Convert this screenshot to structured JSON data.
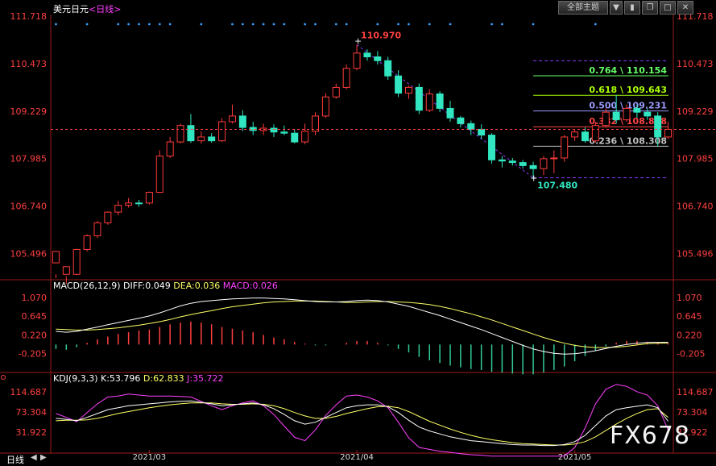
{
  "header": {
    "instrument": "美元日元",
    "period_tag": "<日线>",
    "theme_menu": "全部主题",
    "icons": [
      "dropdown-arrow-icon",
      "toggle-panel-icon",
      "restore-window-icon",
      "maximize-icon",
      "close-icon"
    ]
  },
  "colors": {
    "up": "#ff3a3a",
    "down": "#31e6c0",
    "background": "#000000",
    "grid": "#9b1b1b",
    "axis_text": "#ff4040",
    "diff": "#ffffff",
    "dea": "#ffff66",
    "macd_hist_pos": "#ff4040",
    "macd_hist_neg": "#33cc99",
    "k": "#ffffff",
    "d": "#ffff66",
    "j": "#ff40ff"
  },
  "chart_data": [
    {
      "type": "candlestick",
      "panel": "price",
      "title": "美元日元<日线>",
      "y_ticks": [
        "111.718",
        "110.473",
        "109.229",
        "107.985",
        "106.740",
        "105.496"
      ],
      "ylim": [
        104.85,
        111.718
      ],
      "last_price": 108.75,
      "high_label": "110.970",
      "low_label": "107.480",
      "x_tick_labels": [
        "2021/03",
        "2021/04",
        "2021/05"
      ],
      "x_tick_index": [
        9,
        29,
        50
      ],
      "fibonacci": [
        {
          "level": "0.764",
          "value": "110.154",
          "color": "#66ff66"
        },
        {
          "level": "0.618",
          "value": "109.643",
          "color": "#aaff00"
        },
        {
          "level": "0.500",
          "value": "109.231",
          "color": "#9999ff"
        },
        {
          "level": "0.382",
          "value": "108.818",
          "color": "#ff4444"
        },
        {
          "level": "0.236",
          "value": "108.308",
          "color": "#c0c0c0"
        }
      ],
      "candles": [
        [
          105.25,
          105.55,
          104.95,
          104.85
        ],
        [
          104.95,
          105.15,
          104.9,
          104.7
        ],
        [
          104.95,
          105.6,
          105.62,
          104.93
        ],
        [
          105.6,
          105.96,
          106.0,
          105.55
        ],
        [
          105.96,
          106.3,
          106.35,
          105.9
        ],
        [
          106.3,
          106.58,
          106.6,
          106.25
        ],
        [
          106.58,
          106.76,
          106.88,
          106.5
        ],
        [
          106.76,
          106.82,
          106.95,
          106.7
        ],
        [
          106.82,
          106.8,
          106.9,
          106.72
        ],
        [
          106.82,
          107.1,
          107.12,
          106.78
        ],
        [
          107.1,
          108.05,
          108.2,
          107.08
        ],
        [
          108.05,
          108.42,
          108.55,
          108.0
        ],
        [
          108.42,
          108.85,
          108.9,
          108.38
        ],
        [
          108.85,
          108.45,
          109.15,
          108.4
        ],
        [
          108.45,
          108.55,
          108.7,
          108.38
        ],
        [
          108.55,
          108.45,
          108.65,
          108.4
        ],
        [
          108.45,
          108.95,
          109.05,
          108.42
        ],
        [
          108.95,
          109.1,
          109.4,
          108.9
        ],
        [
          109.1,
          108.8,
          109.25,
          108.7
        ],
        [
          108.8,
          108.72,
          108.95,
          108.6
        ],
        [
          108.72,
          108.78,
          108.9,
          108.6
        ],
        [
          108.78,
          108.68,
          108.88,
          108.55
        ],
        [
          108.68,
          108.65,
          108.85,
          108.6
        ],
        [
          108.65,
          108.42,
          108.75,
          108.38
        ],
        [
          108.42,
          108.7,
          108.9,
          108.36
        ],
        [
          108.7,
          109.1,
          109.2,
          108.6
        ],
        [
          109.1,
          109.6,
          109.7,
          109.05
        ],
        [
          109.6,
          109.85,
          109.95,
          109.55
        ],
        [
          109.85,
          110.35,
          110.45,
          109.8
        ],
        [
          110.35,
          110.75,
          110.97,
          110.3
        ],
        [
          110.75,
          110.65,
          110.85,
          110.55
        ],
        [
          110.65,
          110.55,
          110.8,
          110.45
        ],
        [
          110.55,
          110.15,
          110.65,
          110.05
        ],
        [
          110.15,
          109.7,
          110.3,
          109.6
        ],
        [
          109.7,
          109.85,
          109.9,
          109.55
        ],
        [
          109.85,
          109.25,
          109.95,
          109.15
        ],
        [
          109.25,
          109.68,
          109.8,
          109.2
        ],
        [
          109.68,
          109.3,
          109.75,
          109.2
        ],
        [
          109.3,
          109.05,
          109.5,
          108.95
        ],
        [
          109.05,
          108.9,
          109.1,
          108.8
        ],
        [
          108.9,
          108.75,
          108.98,
          108.6
        ],
        [
          108.75,
          108.6,
          108.88,
          108.5
        ],
        [
          108.6,
          107.95,
          108.65,
          107.85
        ],
        [
          107.95,
          107.92,
          108.05,
          107.75
        ],
        [
          107.92,
          107.88,
          108.0,
          107.8
        ],
        [
          107.88,
          107.8,
          107.95,
          107.72
        ],
        [
          107.8,
          107.72,
          107.9,
          107.48
        ],
        [
          107.72,
          107.98,
          108.05,
          107.55
        ],
        [
          107.98,
          108.0,
          108.2,
          107.6
        ],
        [
          108.0,
          108.55,
          108.6,
          107.9
        ],
        [
          108.55,
          108.68,
          108.75,
          108.45
        ],
        [
          108.68,
          108.45,
          108.8,
          108.4
        ],
        [
          108.45,
          108.85,
          108.95,
          108.4
        ],
        [
          108.85,
          109.2,
          109.3,
          108.8
        ],
        [
          109.2,
          109.0,
          109.65,
          108.9
        ],
        [
          109.0,
          109.3,
          109.4,
          108.95
        ],
        [
          109.3,
          109.2,
          109.4,
          109.05
        ],
        [
          109.2,
          109.1,
          109.3,
          109.0
        ],
        [
          109.1,
          108.55,
          109.2,
          108.3
        ],
        [
          108.55,
          108.75,
          108.95,
          108.5
        ]
      ]
    },
    {
      "type": "macd",
      "panel": "macd",
      "label": "MACD(26,12,9)",
      "DIFF": "0.049",
      "DEA": "0.036",
      "MACD": "0.026",
      "y_ticks": [
        "1.070",
        "0.645",
        "0.220",
        "-0.205"
      ],
      "ylim": [
        -0.6,
        1.2
      ],
      "diff": [
        0.3,
        0.28,
        0.3,
        0.35,
        0.4,
        0.45,
        0.5,
        0.55,
        0.6,
        0.65,
        0.72,
        0.8,
        0.88,
        0.94,
        0.98,
        1.0,
        1.02,
        1.04,
        1.05,
        1.06,
        1.06,
        1.05,
        1.04,
        1.02,
        1.0,
        0.98,
        0.97,
        0.97,
        0.98,
        1.0,
        1.01,
        1.0,
        0.97,
        0.92,
        0.87,
        0.8,
        0.73,
        0.66,
        0.58,
        0.5,
        0.42,
        0.34,
        0.25,
        0.16,
        0.07,
        -0.02,
        -0.1,
        -0.16,
        -0.2,
        -0.22,
        -0.21,
        -0.18,
        -0.14,
        -0.09,
        -0.04,
        0.0,
        0.03,
        0.05,
        0.05,
        0.05
      ],
      "dea": [
        0.35,
        0.34,
        0.33,
        0.33,
        0.34,
        0.36,
        0.38,
        0.41,
        0.44,
        0.48,
        0.52,
        0.57,
        0.63,
        0.68,
        0.73,
        0.77,
        0.82,
        0.86,
        0.89,
        0.92,
        0.95,
        0.97,
        0.98,
        0.99,
        0.99,
        0.99,
        0.98,
        0.97,
        0.96,
        0.96,
        0.97,
        0.98,
        0.98,
        0.97,
        0.96,
        0.94,
        0.91,
        0.87,
        0.82,
        0.76,
        0.7,
        0.63,
        0.56,
        0.48,
        0.4,
        0.32,
        0.24,
        0.16,
        0.09,
        0.03,
        -0.02,
        -0.05,
        -0.07,
        -0.07,
        -0.06,
        -0.04,
        -0.01,
        0.02,
        0.03,
        0.036
      ]
    },
    {
      "type": "kdj",
      "panel": "kdj",
      "label": "KDJ(9,3,3)",
      "K": "53.796",
      "D": "62.833",
      "J": "35.722",
      "y_ticks": [
        "114.687",
        "73.304",
        "31.922"
      ],
      "ylim": [
        -5,
        128
      ],
      "k": [
        60,
        58,
        55,
        62,
        70,
        78,
        82,
        86,
        88,
        90,
        92,
        94,
        95,
        96,
        93,
        90,
        86,
        88,
        90,
        92,
        88,
        80,
        68,
        55,
        48,
        52,
        62,
        72,
        82,
        86,
        88,
        88,
        84,
        72,
        56,
        42,
        34,
        28,
        22,
        18,
        14,
        12,
        10,
        8,
        6,
        5,
        5,
        4,
        4,
        6,
        12,
        25,
        45,
        65,
        78,
        82,
        85,
        88,
        82,
        54
      ],
      "d": [
        55,
        56,
        56,
        57,
        60,
        65,
        70,
        74,
        78,
        82,
        85,
        88,
        90,
        92,
        92,
        92,
        90,
        89,
        89,
        90,
        89,
        86,
        80,
        72,
        65,
        60,
        60,
        64,
        70,
        75,
        80,
        84,
        85,
        82,
        74,
        64,
        54,
        46,
        38,
        31,
        25,
        20,
        16,
        13,
        10,
        8,
        7,
        6,
        5,
        5,
        7,
        12,
        22,
        35,
        48,
        60,
        70,
        78,
        80,
        62
      ],
      "j": [
        70,
        62,
        53,
        72,
        90,
        104,
        106,
        110,
        108,
        106,
        106,
        106,
        105,
        104,
        95,
        86,
        78,
        86,
        92,
        96,
        86,
        68,
        44,
        21,
        14,
        36,
        66,
        88,
        106,
        108,
        104,
        96,
        82,
        52,
        20,
        0,
        -4,
        -8,
        -10,
        -13,
        -15,
        -16,
        -18,
        -18,
        -18,
        -18,
        -18,
        -18,
        -18,
        -18,
        0,
        40,
        90,
        120,
        130,
        126,
        115,
        108,
        86,
        36
      ]
    }
  ],
  "bottom": {
    "period_tab": "日线",
    "arrows": [
      "scroll-left-icon",
      "scroll-right-icon"
    ]
  },
  "watermark": "FX678"
}
